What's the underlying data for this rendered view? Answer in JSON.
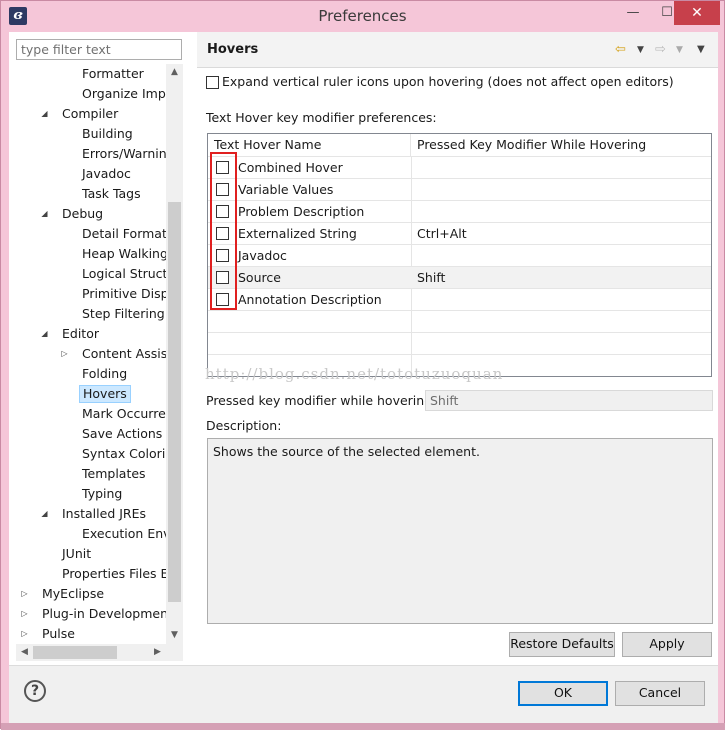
{
  "window": {
    "title": "Preferences",
    "app_icon": "eclipse-logo",
    "minimize_glyph": "—",
    "maximize_glyph": "☐",
    "close_glyph": "✕"
  },
  "filter": {
    "placeholder": "type filter text"
  },
  "tree": [
    {
      "label": "Formatter",
      "indent": 3
    },
    {
      "label": "Organize Impo",
      "indent": 3
    },
    {
      "label": "Compiler",
      "indent": 2,
      "twisty": "◢"
    },
    {
      "label": "Building",
      "indent": 3
    },
    {
      "label": "Errors/Warning",
      "indent": 3
    },
    {
      "label": "Javadoc",
      "indent": 3
    },
    {
      "label": "Task Tags",
      "indent": 3
    },
    {
      "label": "Debug",
      "indent": 2,
      "twisty": "◢"
    },
    {
      "label": "Detail Formatte",
      "indent": 3
    },
    {
      "label": "Heap Walking",
      "indent": 3
    },
    {
      "label": "Logical Structur",
      "indent": 3
    },
    {
      "label": "Primitive Displa",
      "indent": 3
    },
    {
      "label": "Step Filtering",
      "indent": 3
    },
    {
      "label": "Editor",
      "indent": 2,
      "twisty": "◢"
    },
    {
      "label": "Content Assist",
      "indent": 3,
      "twisty": "▷"
    },
    {
      "label": "Folding",
      "indent": 3
    },
    {
      "label": "Hovers",
      "indent": 3,
      "selected": true
    },
    {
      "label": "Mark Occurren",
      "indent": 3
    },
    {
      "label": "Save Actions",
      "indent": 3
    },
    {
      "label": "Syntax Coloring",
      "indent": 3
    },
    {
      "label": "Templates",
      "indent": 3
    },
    {
      "label": "Typing",
      "indent": 3
    },
    {
      "label": "Installed JREs",
      "indent": 2,
      "twisty": "◢"
    },
    {
      "label": "Execution Envir",
      "indent": 3
    },
    {
      "label": "JUnit",
      "indent": 2
    },
    {
      "label": "Properties Files Ed",
      "indent": 2
    },
    {
      "label": "MyEclipse",
      "indent": 1,
      "twisty": "▷"
    },
    {
      "label": "Plug-in Development",
      "indent": 1,
      "twisty": "▷"
    },
    {
      "label": "Pulse",
      "indent": 1,
      "twisty": "▷"
    }
  ],
  "scroll": {
    "up": "▲",
    "down": "▼",
    "left": "◀",
    "right": "▶"
  },
  "page": {
    "title": "Hovers",
    "nav": {
      "back": "⇦",
      "back_dd": "▼",
      "fwd": "⇨",
      "fwd_dd": "▼",
      "menu": "▼"
    },
    "expand_checkbox_label": "Expand vertical ruler icons upon hovering (does not affect open editors)",
    "expand_checked": false,
    "key_prefs_label": "Text Hover key modifier preferences:",
    "table": {
      "columns": [
        "Text Hover Name",
        "Pressed Key Modifier While Hovering"
      ],
      "rows": [
        {
          "name": "Combined Hover",
          "modifier": "",
          "checked": false
        },
        {
          "name": "Variable Values",
          "modifier": "",
          "checked": false
        },
        {
          "name": "Problem Description",
          "modifier": "",
          "checked": false
        },
        {
          "name": "Externalized String",
          "modifier": "Ctrl+Alt",
          "checked": false
        },
        {
          "name": "Javadoc",
          "modifier": "",
          "checked": false
        },
        {
          "name": "Source",
          "modifier": "Shift",
          "checked": false,
          "selected": true
        },
        {
          "name": "Annotation Description",
          "modifier": "",
          "checked": false
        }
      ]
    },
    "watermark": "http://blog.csdn.net/tototuzuoquan",
    "modifier_label": "Pressed key modifier while hovering:",
    "modifier_value": "Shift",
    "description_label": "Description:",
    "description_text": "Shows the source of the selected element.",
    "restore_defaults": "Restore Defaults",
    "apply": "Apply"
  },
  "bottom": {
    "help": "?",
    "ok": "OK",
    "cancel": "Cancel"
  },
  "colors": {
    "title_bar": "#f5c6d8",
    "close_button": "#c7404b",
    "selection": "#cce8ff",
    "highlight_box": "#e02020"
  }
}
